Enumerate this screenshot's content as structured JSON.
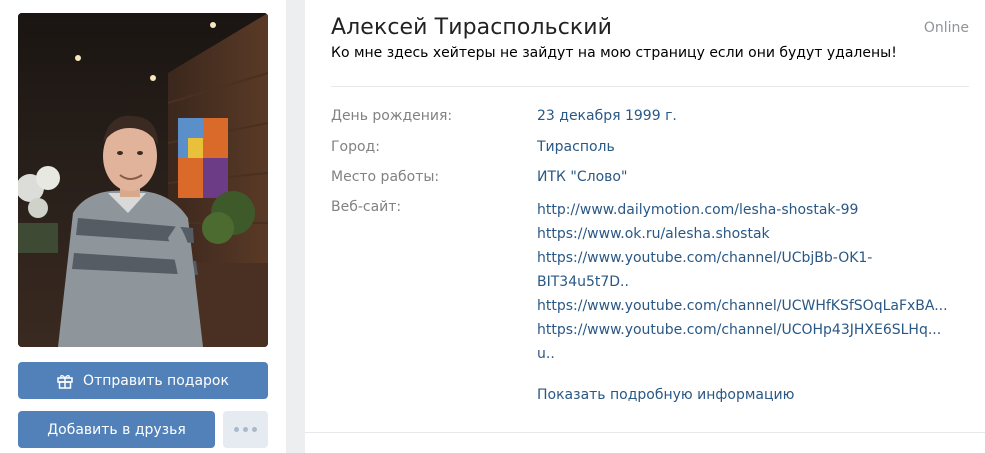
{
  "profile": {
    "name": "Алексей Тираспольский",
    "online": "Online",
    "status": "Ко мне здесь хейтеры не зайдут на мою страницу если они будут удалены!"
  },
  "actions": {
    "gift_label": "Отправить подарок",
    "friend_label": "Добавить в друзья"
  },
  "info": {
    "birthday_label": "День рождения:",
    "birthday_value": "23 декабря 1999 г.",
    "city_label": "Город:",
    "city_value": "Тирасполь",
    "work_label": "Место работы:",
    "work_value": "ИТК \"Слово\"",
    "website_label": "Веб-сайт:",
    "websites": [
      "http://www.dailymotion.com/lesha-shostak-99",
      "https://www.ok.ru/alesha.shostak",
      "https://www.youtube.com/channel/UCbjBb-OK1-",
      "BIT34u5t7D..",
      "https://www.youtube.com/channel/UCWHfKSfSOqLaFxBA...",
      "https://www.youtube.com/channel/UCOHp43JHXE6SLHq...",
      "u.."
    ],
    "more_label": "Показать подробную информацию"
  },
  "icons": {
    "gift": "gift-icon",
    "more": "more-dots-icon"
  },
  "colors": {
    "accent": "#5181b8",
    "link": "#2a5885",
    "label": "#828282",
    "background": "#edeef0"
  }
}
